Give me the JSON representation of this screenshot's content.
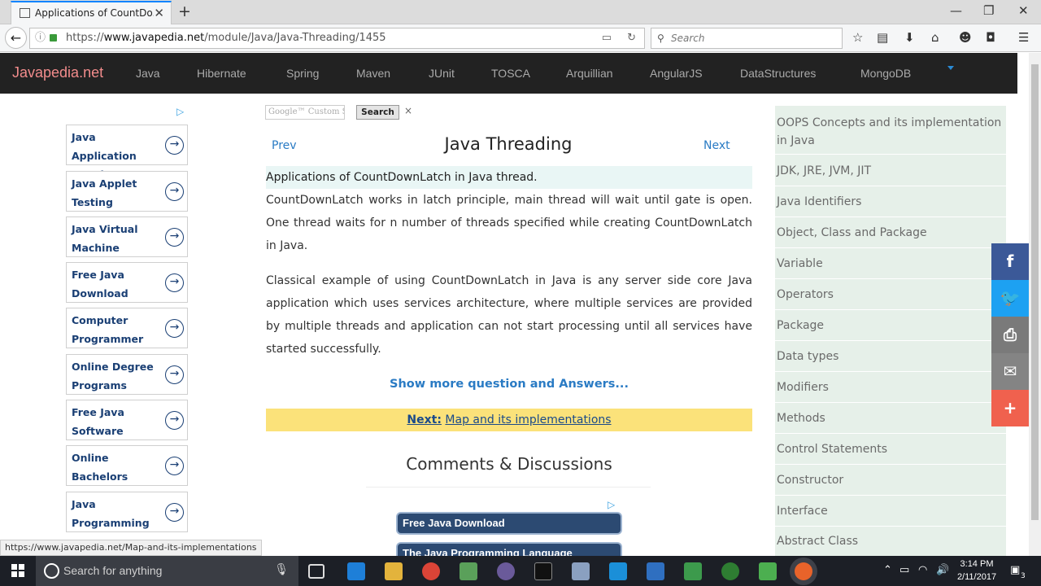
{
  "browser": {
    "tab_title": "Applications of CountDo...",
    "url_prefix": "https://",
    "url_host": "www.javapedia.net",
    "url_path": "/module/Java/Java-Threading/1455",
    "search_placeholder": "Search"
  },
  "site": {
    "logo": "Javapedia.net",
    "nav": [
      "Java",
      "Hibernate",
      "Spring",
      "Maven",
      "JUnit",
      "TOSCA",
      "Arquillian",
      "AngularJS",
      "DataStructures",
      "MongoDB"
    ]
  },
  "ads_left": [
    "Java Application Development",
    "Java Applet Testing",
    "Java Virtual Machine",
    "Free Java Download",
    "Computer Programmer",
    "Online Degree Programs",
    "Free Java Software",
    "Online Bachelors",
    "Java Programming"
  ],
  "search_box": {
    "placeholder": "Google™ Custom Sea",
    "button": "Search",
    "close": "×"
  },
  "article": {
    "prev": "Prev",
    "next": "Next",
    "title": "Java Threading",
    "question": "Applications of CountDownLatch in Java thread.",
    "para1": "CountDownLatch works in latch principle, main thread will wait until gate is open. One thread waits for n number of threads specified while creating CountDownLatch in Java.",
    "para2": "Classical example of using CountDownLatch in Java is any server side core Java application which uses services architecture, where multiple services are provided by multiple threads and application can not start processing until all services have started successfully.",
    "more": "Show more question and Answers...",
    "next_label": "Next:",
    "next_link": "Map and its implementations",
    "comments": "Comments & Discussions"
  },
  "ads_bottom": [
    "Free Java Download",
    "The Java Programming Language"
  ],
  "sidebar": [
    "OOPS Concepts and its implementation in Java",
    "JDK, JRE, JVM, JIT",
    "Java Identifiers",
    "Object, Class and Package",
    "Variable",
    "Operators",
    "Package",
    "Data types",
    "Modifiers",
    "Methods",
    "Control Statements",
    "Constructor",
    "Interface",
    "Abstract Class"
  ],
  "status_url": "https://www.javapedia.net/Map-and-its-implementations",
  "taskbar": {
    "search": "Search for anything",
    "time": "3:14 PM",
    "date": "2/11/2017",
    "notifications": "3"
  },
  "colors": {
    "facebook": "#3b5998",
    "twitter": "#1da1f2",
    "print": "#7a7a7a",
    "email": "#848484",
    "more": "#f0614e"
  }
}
